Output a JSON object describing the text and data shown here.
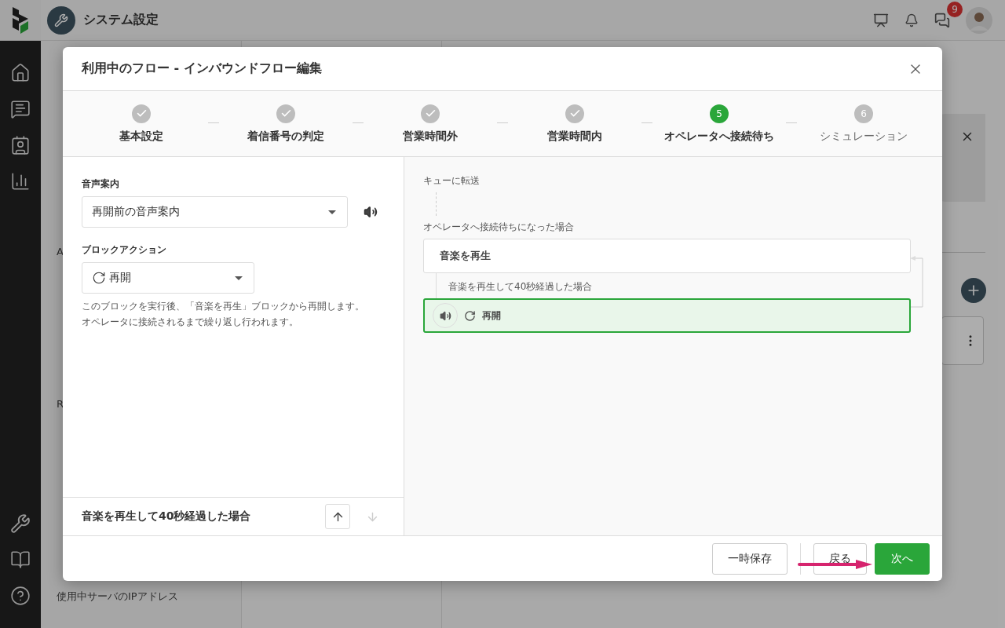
{
  "app_header": {
    "title": "システム設定",
    "chat_badge": "9"
  },
  "background_nav": {
    "items": [
      {
        "label": "A"
      },
      {
        "label": "R"
      },
      {
        "label": "使用中サーバのIPアドレス"
      }
    ]
  },
  "dialog": {
    "title": "利用中のフロー - インバウンドフロー編集",
    "steps": [
      {
        "label": "基本設定",
        "completed": true,
        "selected": false
      },
      {
        "label": "着信番号の判定",
        "completed": true,
        "selected": false
      },
      {
        "label": "営業時間外",
        "completed": true,
        "selected": false
      },
      {
        "label": "営業時間内",
        "completed": true,
        "selected": false
      },
      {
        "label": "オペレータへ接続待ち",
        "completed": false,
        "selected": true,
        "number": "5"
      },
      {
        "label": "シミュレーション",
        "completed": false,
        "selected": false,
        "number": "6"
      }
    ],
    "form": {
      "voice_label": "音声案内",
      "voice_value": "再開前の音声案内",
      "action_label": "ブロックアクション",
      "action_value": "再開",
      "description_lines": [
        "このブロックを実行後、「音楽を再生」ブロックから再開します。",
        "オペレータに接続されるまで繰り返し行われます。"
      ]
    },
    "block_nav": {
      "label": "音楽を再生して40秒経過した場合",
      "up_disabled": false,
      "down_disabled": true
    },
    "flow": {
      "entry_label": "キューに転送",
      "condition_label": "オペレータへ接続待ちになった場合",
      "play_block": {
        "title": "音楽を再生",
        "selected": false
      },
      "branch_label": "音楽を再生して40秒経過した場合",
      "action_block": {
        "title": "再開",
        "selected": true
      }
    },
    "footer": {
      "buttons": [
        {
          "label": "一時保存",
          "kind": "secondary"
        },
        {
          "label": "戻る",
          "kind": "secondary"
        },
        {
          "label": "次へ",
          "kind": "primary"
        }
      ]
    }
  }
}
